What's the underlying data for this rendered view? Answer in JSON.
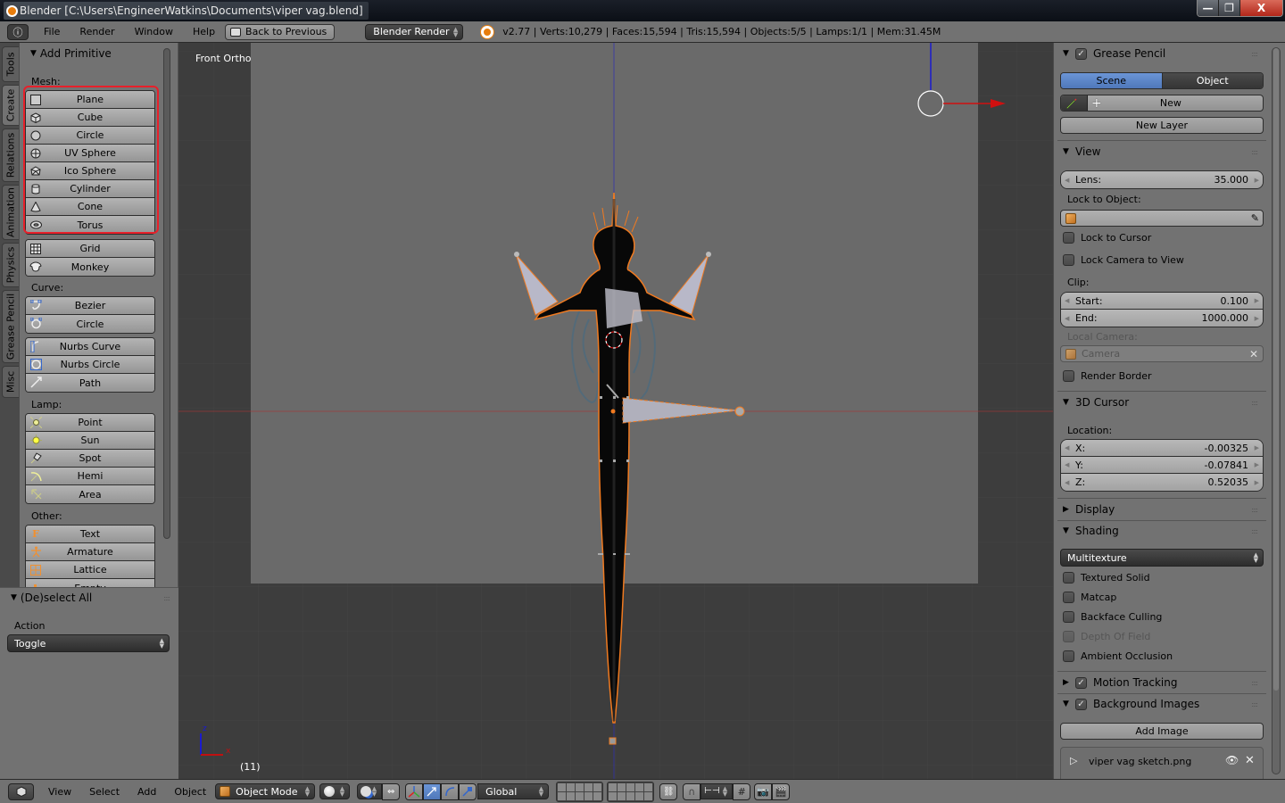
{
  "window": {
    "title": "Blender [C:\\Users\\EngineerWatkins\\Documents\\viper vag.blend]",
    "controls": {
      "minimize": "—",
      "maximize": "❐",
      "close": "X"
    }
  },
  "topbar": {
    "editor_icon": "ⓘ",
    "menus": [
      "File",
      "Render",
      "Window",
      "Help"
    ],
    "back_button": "Back to Previous",
    "render_engine": "Blender Render",
    "stats": "v2.77 | Verts:10,279 | Faces:15,594 | Tris:15,594 | Objects:5/5 | Lamps:1/1 | Mem:31.45M"
  },
  "left_tabs": [
    "Tools",
    "Create",
    "Relations",
    "Animation",
    "Physics",
    "Grease Pencil",
    "Misc"
  ],
  "active_left_tab": "Create",
  "toolshelf": {
    "panel_title": "Add Primitive",
    "sections": {
      "mesh": {
        "label": "Mesh:",
        "group1": [
          {
            "label": "Plane",
            "icon": "plane-icon"
          },
          {
            "label": "Cube",
            "icon": "cube-icon"
          },
          {
            "label": "Circle",
            "icon": "circle-icon"
          },
          {
            "label": "UV Sphere",
            "icon": "uv-sphere-icon"
          },
          {
            "label": "Ico Sphere",
            "icon": "ico-sphere-icon"
          },
          {
            "label": "Cylinder",
            "icon": "cylinder-icon"
          },
          {
            "label": "Cone",
            "icon": "cone-icon"
          },
          {
            "label": "Torus",
            "icon": "torus-icon"
          }
        ],
        "group2": [
          {
            "label": "Grid",
            "icon": "grid-icon"
          },
          {
            "label": "Monkey",
            "icon": "monkey-icon"
          }
        ]
      },
      "curve": {
        "label": "Curve:",
        "group1": [
          {
            "label": "Bezier",
            "icon": "bezier-icon"
          },
          {
            "label": "Circle",
            "icon": "curve-circle-icon"
          }
        ],
        "group2": [
          {
            "label": "Nurbs Curve",
            "icon": "nurbs-curve-icon"
          },
          {
            "label": "Nurbs Circle",
            "icon": "nurbs-circle-icon"
          },
          {
            "label": "Path",
            "icon": "path-icon"
          }
        ]
      },
      "lamp": {
        "label": "Lamp:",
        "items": [
          {
            "label": "Point",
            "icon": "point-lamp-icon"
          },
          {
            "label": "Sun",
            "icon": "sun-lamp-icon"
          },
          {
            "label": "Spot",
            "icon": "spot-lamp-icon"
          },
          {
            "label": "Hemi",
            "icon": "hemi-lamp-icon"
          },
          {
            "label": "Area",
            "icon": "area-lamp-icon"
          }
        ]
      },
      "other": {
        "label": "Other:",
        "items": [
          {
            "label": "Text",
            "icon": "text-icon"
          },
          {
            "label": "Armature",
            "icon": "armature-icon"
          },
          {
            "label": "Lattice",
            "icon": "lattice-icon"
          },
          {
            "label": "Empty",
            "icon": "empty-icon"
          }
        ]
      }
    }
  },
  "redo_panel": {
    "title": "(De)select All",
    "action_label": "Action",
    "action_value": "Toggle"
  },
  "viewport": {
    "view_name": "Front Ortho",
    "frame": "(11)",
    "axis_labels": {
      "z": "z",
      "x": "x"
    }
  },
  "properties": {
    "grease_pencil": {
      "title": "Grease Pencil",
      "enabled": true,
      "tabs": [
        "Scene",
        "Object"
      ],
      "active_tab": "Scene",
      "new_label": "New",
      "new_layer_label": "New Layer"
    },
    "view": {
      "title": "View",
      "lens_label": "Lens:",
      "lens_value": "35.000",
      "lock_to_object_label": "Lock to Object:",
      "lock_to_object_value": "",
      "lock_to_cursor": "Lock to Cursor",
      "lock_camera_to_view": "Lock Camera to View",
      "clip_label": "Clip:",
      "clip_start_label": "Start:",
      "clip_start_value": "0.100",
      "clip_end_label": "End:",
      "clip_end_value": "1000.000",
      "local_camera_label": "Local Camera:",
      "local_camera_value": "Camera",
      "render_border": "Render Border"
    },
    "cursor": {
      "title": "3D Cursor",
      "location_label": "Location:",
      "x_label": "X:",
      "x_value": "-0.00325",
      "y_label": "Y:",
      "y_value": "-0.07841",
      "z_label": "Z:",
      "z_value": "0.52035"
    },
    "display": {
      "title": "Display"
    },
    "shading": {
      "title": "Shading",
      "mode": "Multitexture",
      "options": [
        "Textured Solid",
        "Matcap",
        "Backface Culling",
        "Depth Of Field",
        "Ambient Occlusion"
      ]
    },
    "motion_tracking": {
      "title": "Motion Tracking",
      "enabled": true
    },
    "background_images": {
      "title": "Background Images",
      "enabled": true,
      "add_label": "Add Image",
      "image_name": "viper vag sketch.png"
    }
  },
  "bottombar": {
    "menus": [
      "View",
      "Select",
      "Add",
      "Object"
    ],
    "mode": "Object Mode",
    "orientation": "Global"
  },
  "colors": {
    "selection_orange": "#f07a20",
    "active_tab_blue": "#5a86cc",
    "annotation_red": "#e8202a",
    "x_axis": "#d01010",
    "z_axis": "#1010d0"
  }
}
